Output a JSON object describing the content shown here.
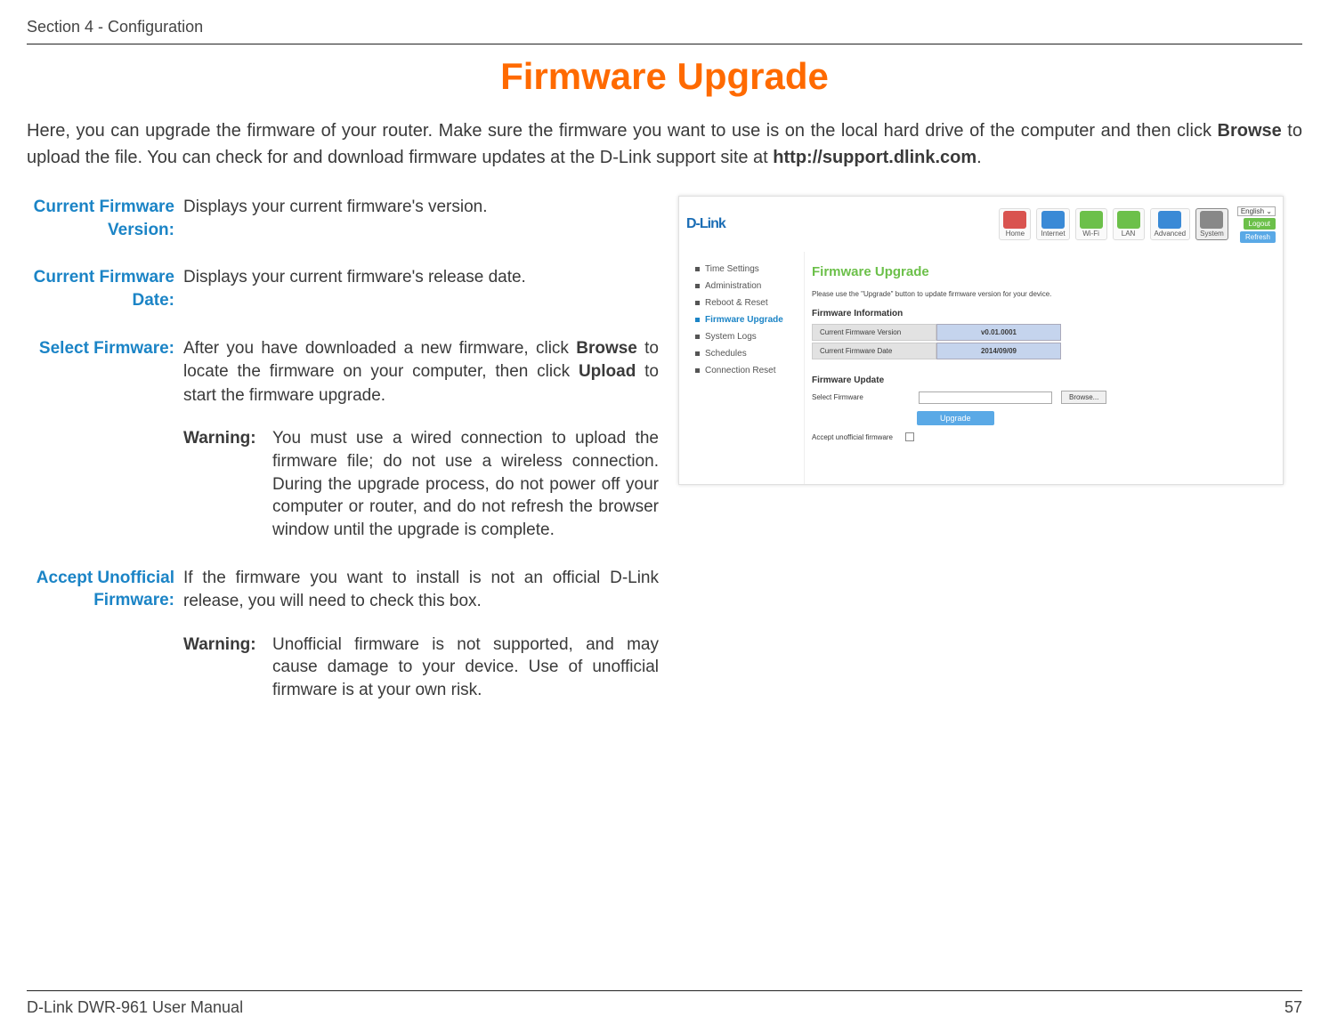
{
  "header": {
    "section": "Section 4 - Configuration"
  },
  "title": "Firmware Upgrade",
  "intro_parts": {
    "p1": "Here, you can upgrade the firmware of your router. Make sure the firmware you want to use is on the local hard drive of the computer and then click ",
    "b1": "Browse",
    "p2": " to upload the file. You can check for and download firmware updates at the D-Link support site at ",
    "b2": "http://support.dlink.com",
    "p3": "."
  },
  "rows": {
    "current_version": {
      "label": "Current Firmware Version:",
      "desc": "Displays your current firmware's version."
    },
    "current_date": {
      "label": "Current Firmware Date:",
      "desc": "Displays your current firmware's release date."
    },
    "select_firmware": {
      "label": "Select Firmware:",
      "desc_p1": "After you have downloaded a new firmware, click ",
      "desc_b1": "Browse",
      "desc_p2": " to locate the firmware on your computer, then click ",
      "desc_b2": "Upload",
      "desc_p3": " to start the firmware upgrade.",
      "warning_label": "Warning:",
      "warning_text": "You must use a wired connection to upload the firmware file; do not use a wireless connection. During the upgrade process, do not power off your computer or router, and do not refresh the browser window until the upgrade is complete."
    },
    "accept_unofficial": {
      "label": "Accept Unofficial Firmware:",
      "desc": "If the firmware you want to install is not an official D-Link release, you will need to check this box.",
      "warning_label": "Warning:",
      "warning_text": "Unofficial firmware is not supported, and may cause damage to your device. Use of unofficial firmware is at your own risk."
    }
  },
  "screenshot": {
    "logo": "D-Link",
    "lang": "English",
    "logout": "Logout",
    "reload": "Refresh",
    "nav": [
      "Home",
      "Internet",
      "Wi-Fi",
      "LAN",
      "Advanced",
      "System"
    ],
    "nav_colors": [
      "#d9534f",
      "#3a8ad6",
      "#6cc04a",
      "#6cc04a",
      "#3a8ad6",
      "#888"
    ],
    "sidebar": [
      "Time Settings",
      "Administration",
      "Reboot & Reset",
      "Firmware Upgrade",
      "System Logs",
      "Schedules",
      "Connection Reset"
    ],
    "sidebar_active_index": 3,
    "panel_title": "Firmware Upgrade",
    "panel_sub": "Please use the \"Upgrade\" button to update firmware version for your device.",
    "sect_info": "Firmware Information",
    "info_k1": "Current Firmware Version",
    "info_v1": "v0.01.0001",
    "info_k2": "Current Firmware Date",
    "info_v2": "2014/09/09",
    "sect_update": "Firmware Update",
    "select_lbl": "Select Firmware",
    "browse_btn": "Browse...",
    "upgrade_btn": "Upgrade",
    "accept_lbl": "Accept unofficial firmware"
  },
  "footer": {
    "left": "D-Link DWR-961 User Manual",
    "right": "57"
  }
}
